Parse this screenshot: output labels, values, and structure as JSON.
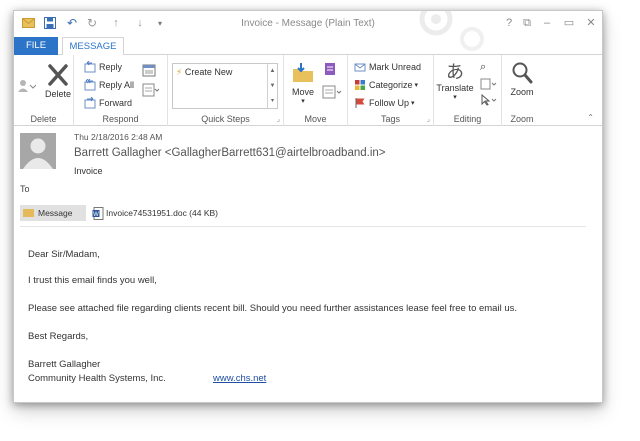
{
  "window": {
    "title": "Invoice - Message (Plain Text)",
    "help_label": "?",
    "accent_color": "#2b74c7"
  },
  "qat": {
    "icons": [
      "mail-icon",
      "save-icon",
      "undo-icon",
      "redo-icon",
      "up-arrow-icon",
      "down-arrow-icon",
      "customize-icon"
    ]
  },
  "tabs": {
    "file": "FILE",
    "message": "MESSAGE"
  },
  "ribbon": {
    "delete_group": {
      "delete_label": "Delete",
      "group_label": "Delete"
    },
    "respond_group": {
      "reply": "Reply",
      "reply_all": "Reply All",
      "forward": "Forward",
      "group_label": "Respond"
    },
    "quick_steps_group": {
      "item": "Create New",
      "group_label": "Quick Steps"
    },
    "move_group": {
      "move_label": "Move",
      "group_label": "Move"
    },
    "tags_group": {
      "mark_unread": "Mark Unread",
      "categorize": "Categorize",
      "follow_up": "Follow Up",
      "group_label": "Tags"
    },
    "editing_group": {
      "translate": "Translate",
      "group_label": "Editing"
    },
    "zoom_group": {
      "zoom": "Zoom",
      "group_label": "Zoom"
    }
  },
  "message": {
    "datetime": "Thu 2/18/2016 2:48 AM",
    "from": "Barrett Gallagher <GallagherBarrett631@airtelbroadband.in>",
    "subject": "Invoice",
    "to_label": "To"
  },
  "attachments": {
    "message_label": "Message",
    "file": "Invoice74531951.doc (44 KB)"
  },
  "body": {
    "greeting": "Dear Sir/Madam,",
    "line1": "I trust this email finds you well,",
    "line2": "Please see attached file regarding clients recent bill. Should you need further assistances lease feel free to email us.",
    "closing": "Best Regards,",
    "sig_name": "Barrett Gallagher",
    "sig_company": "Community Health Systems, Inc.",
    "sig_link": "www.chs.net"
  }
}
